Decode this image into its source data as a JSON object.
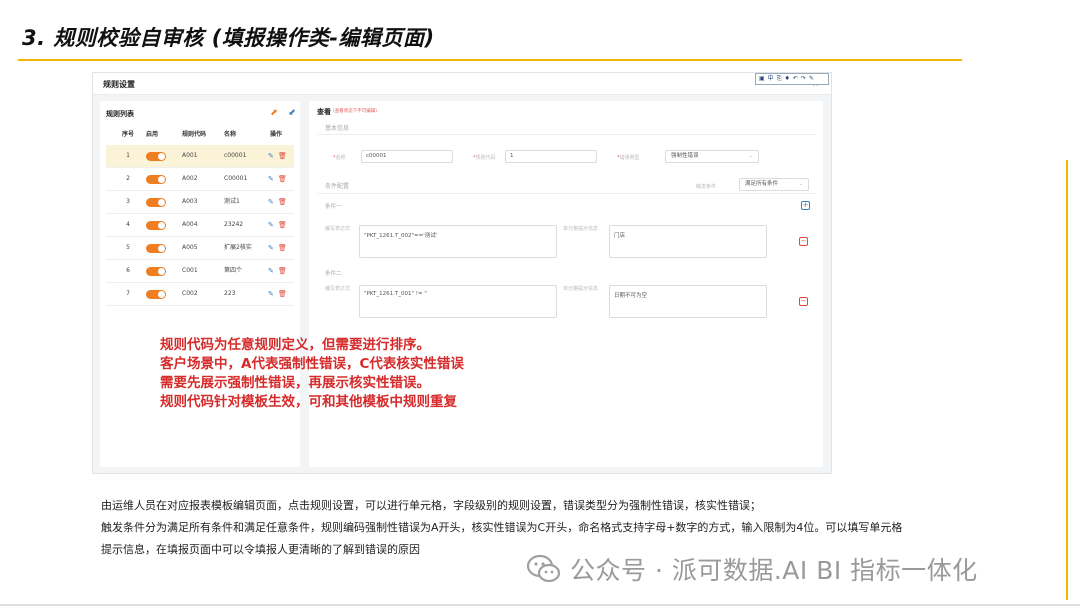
{
  "slide": {
    "title": "3. 规则校验自审核 (填报操作类-编辑页面)"
  },
  "window": {
    "title": "规则设置",
    "close": "×",
    "toolbar_icons": [
      "document-icon",
      "split-icon",
      "copy-icon",
      "tag-icon",
      "undo-icon",
      "redo-icon",
      "pin-icon"
    ]
  },
  "rule_list": {
    "title": "规则列表",
    "headers": {
      "no": "序号",
      "enabled": "启用",
      "code": "规则代码",
      "name": "名称",
      "op": "操作"
    },
    "rows": [
      {
        "no": "1",
        "enabled": true,
        "code": "A001",
        "name": "c00001",
        "selected": true
      },
      {
        "no": "2",
        "enabled": true,
        "code": "A002",
        "name": "C00001",
        "selected": false
      },
      {
        "no": "3",
        "enabled": true,
        "code": "A003",
        "name": "测试1",
        "selected": false
      },
      {
        "no": "4",
        "enabled": true,
        "code": "A004",
        "name": "23242",
        "selected": false
      },
      {
        "no": "5",
        "enabled": true,
        "code": "A005",
        "name": "扩展2核实",
        "selected": false
      },
      {
        "no": "6",
        "enabled": true,
        "code": "C001",
        "name": "第四个",
        "selected": false
      },
      {
        "no": "7",
        "enabled": true,
        "code": "C002",
        "name": "223",
        "selected": false
      }
    ]
  },
  "detail": {
    "title": "查看",
    "note": "(查看状态下不可编辑)",
    "basic_section": "基本信息",
    "name_label": "名称",
    "name_value": "c00001",
    "code_label": "规则代码",
    "code_value": "1",
    "type_label": "错误类型",
    "type_value": "强制性错误",
    "condition_section": "条件配置",
    "trigger_label": "触发条件",
    "trigger_value": "满足所有条件",
    "cond1_title": "条件一",
    "cond2_title": "条件二",
    "formula_label": "编写表达式",
    "tip_label": "单元格提示信息",
    "cond1_formula": "\"PKT_1261.T_002\"=='测试'",
    "cond1_tip": "门店",
    "cond2_formula": "\"PKT_1261.T_001\" != \"",
    "cond2_tip": "日期不可为空"
  },
  "annotation": {
    "lines": [
      "规则代码为任意规则定义，但需要进行排序。",
      "客户场景中，A代表强制性错误，C代表核实性错误",
      "需要先展示强制性错误，再展示核实性错误。",
      "规则代码针对模板生效，可和其他模板中规则重复"
    ]
  },
  "description": {
    "lines": [
      "由运维人员在对应报表模板编辑页面，点击规则设置，可以进行单元格，字段级别的规则设置，错误类型分为强制性错误，核实性错误；",
      "触发条件分为满足所有条件和满足任意条件，规则编码强制性错误为A开头，核实性错误为C开头，命名格式支持字母+数字的方式，输入限制为4位。可以填写单元格",
      "提示信息，在填报页面中可以令填报人更清晰的了解到错误的原因"
    ]
  },
  "watermark": {
    "text": "公众号 · 派可数据.AI BI 指标一体化"
  },
  "colors": {
    "accent_yellow": "#f2b705",
    "toggle_orange": "#ef7d22",
    "annotation_red": "#d62b2b",
    "selected_row": "#fbf3d8"
  }
}
